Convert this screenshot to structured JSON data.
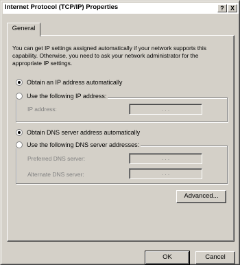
{
  "window": {
    "title": "Internet Protocol (TCP/IP) Properties",
    "help_label": "?",
    "close_label": "X"
  },
  "tabs": [
    {
      "label": "General",
      "selected": true
    }
  ],
  "intro_text": "You can get IP settings assigned automatically if your network supports this capability. Otherwise, you need to ask your network administrator for the appropriate IP settings.",
  "ip_options": {
    "auto": {
      "label": "Obtain an IP address automatically",
      "selected": true
    },
    "manual": {
      "label": "Use the following IP address:",
      "selected": false
    },
    "ip_address_label": "IP address:",
    "ip_address_value": ". . ."
  },
  "dns_options": {
    "auto": {
      "label": "Obtain DNS server address automatically",
      "selected": true
    },
    "manual": {
      "label": "Use the following DNS server addresses:",
      "selected": false
    },
    "preferred_label": "Preferred DNS server:",
    "preferred_value": ". . .",
    "alternate_label": "Alternate DNS server:",
    "alternate_value": ". . ."
  },
  "buttons": {
    "advanced": "Advanced...",
    "ok": "OK",
    "cancel": "Cancel"
  }
}
